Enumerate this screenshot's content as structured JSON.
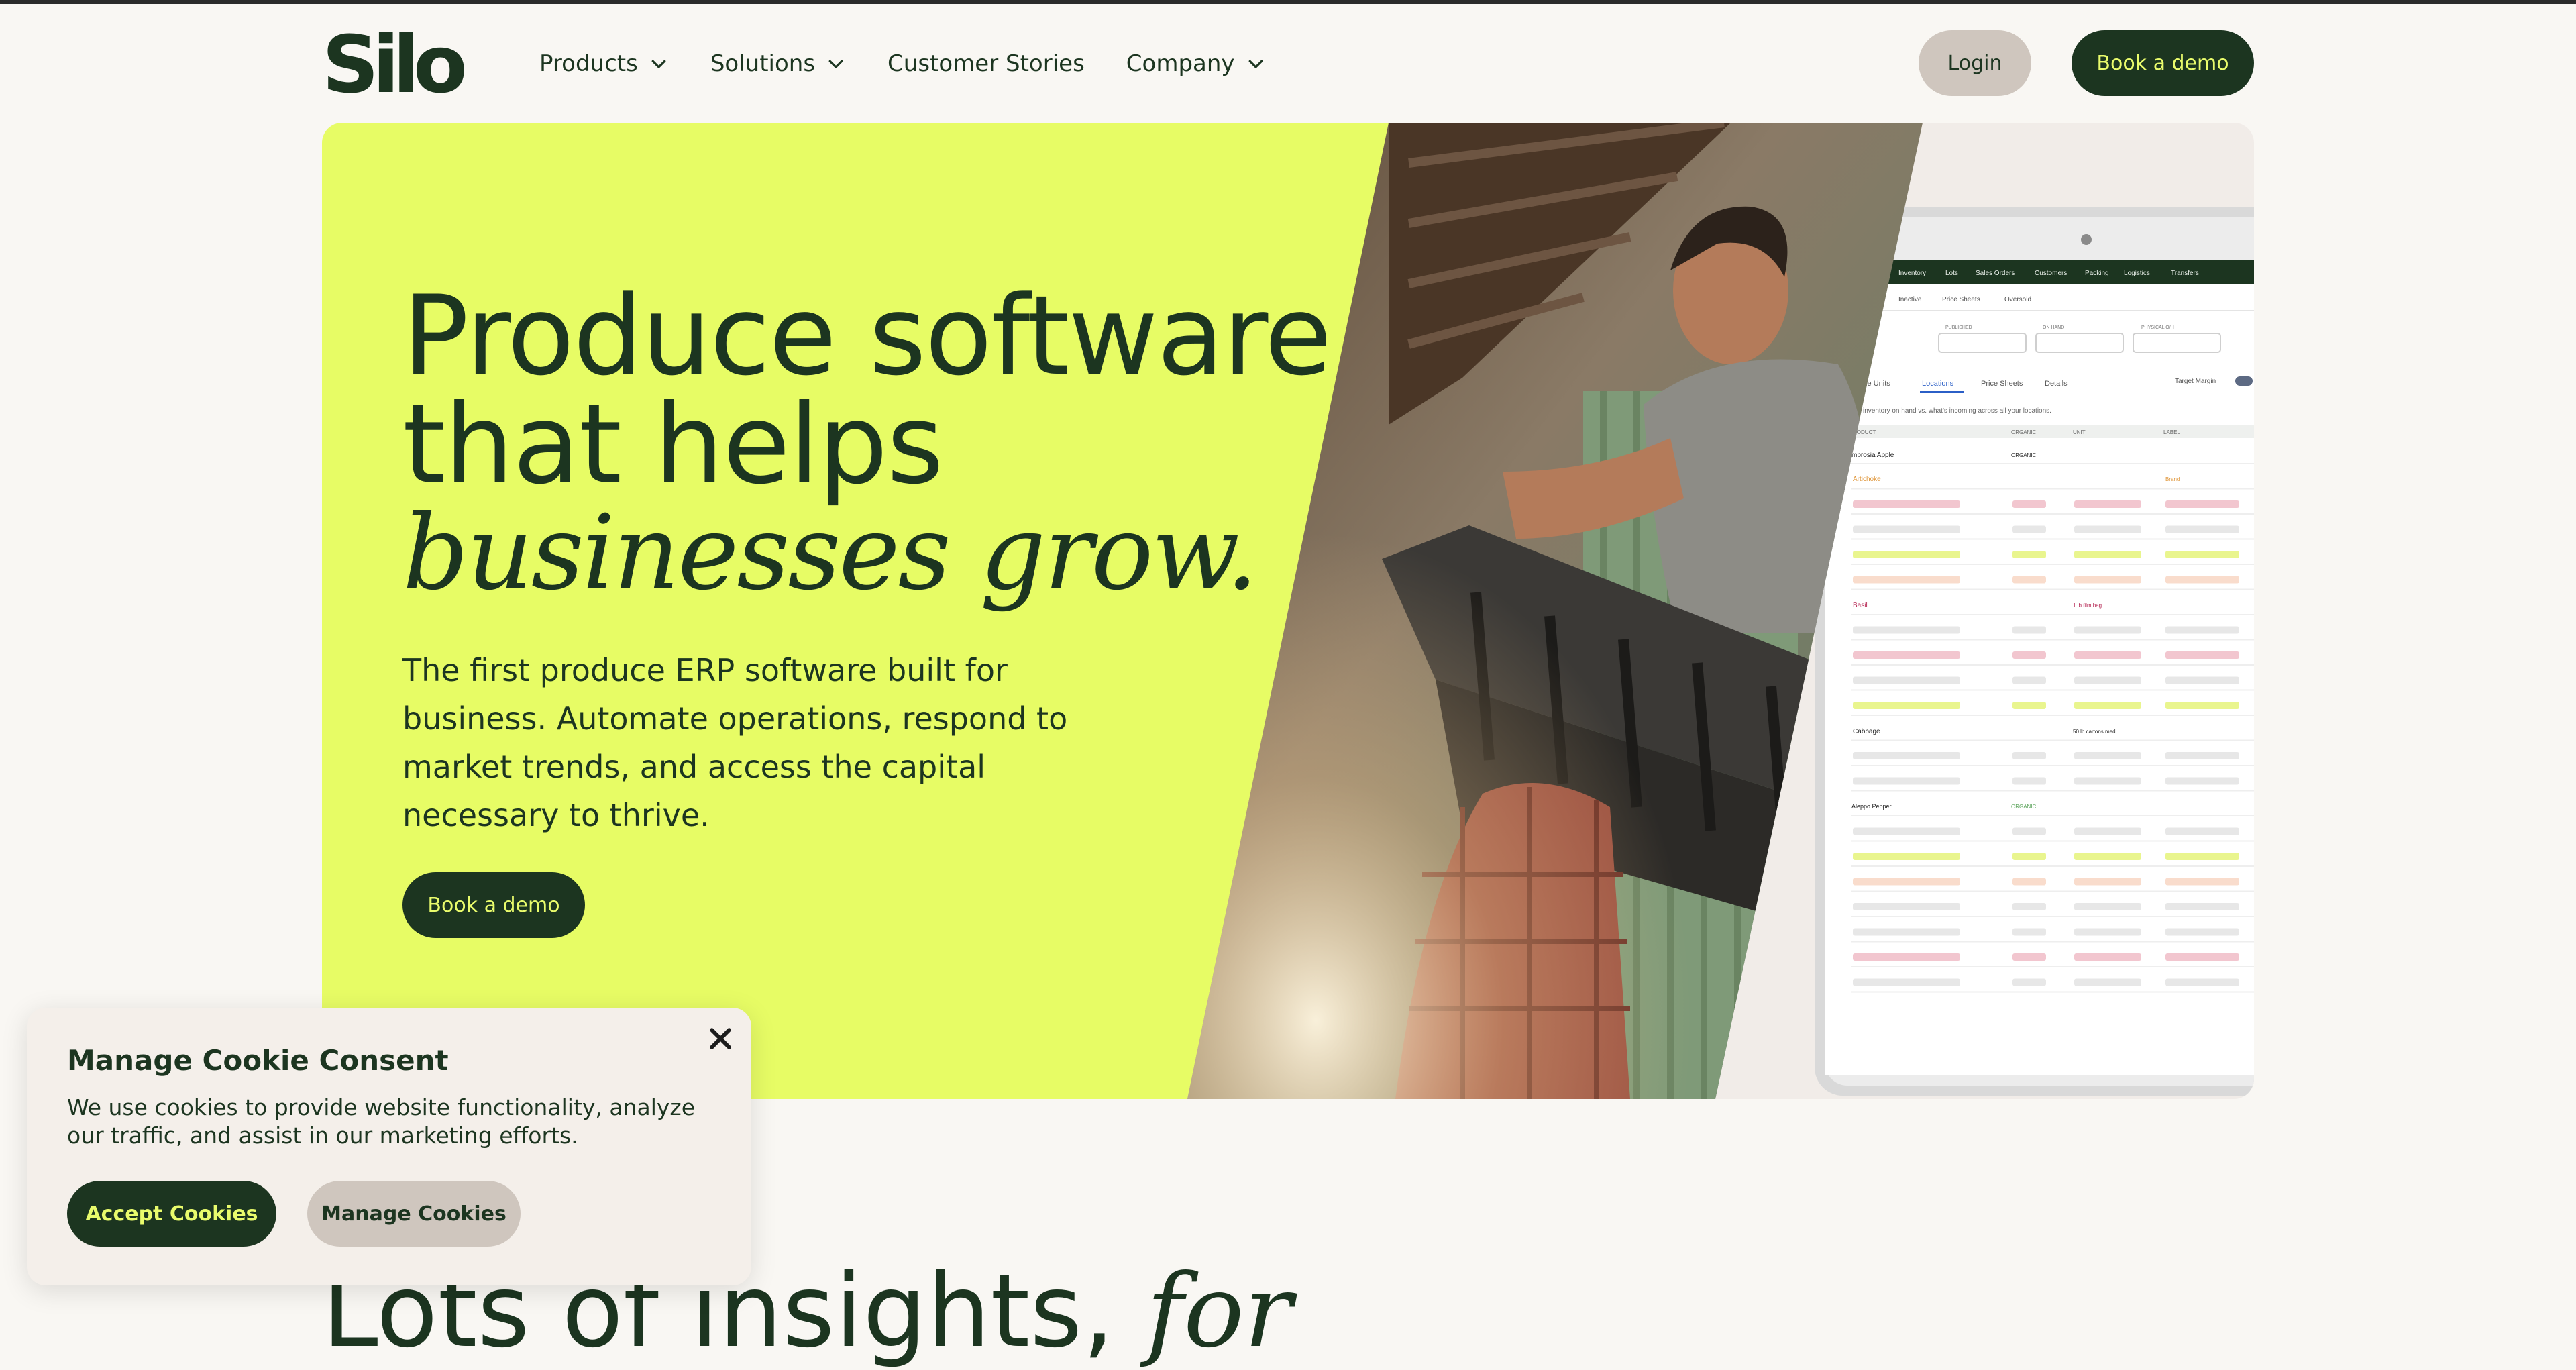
{
  "brand": {
    "logo": "Silo",
    "accent": "#e9fb6c",
    "dark": "#1c3520"
  },
  "nav": {
    "items": [
      {
        "label": "Products",
        "dropdown": true
      },
      {
        "label": "Solutions",
        "dropdown": true
      },
      {
        "label": "Customer Stories",
        "dropdown": false
      },
      {
        "label": "Company",
        "dropdown": true
      }
    ],
    "login": "Login",
    "demo": "Book a demo"
  },
  "hero": {
    "title_line1": "Produce software",
    "title_line2": "that helps",
    "title_italic": "businesses grow.",
    "description": "The first produce ERP software built for business. Automate operations, respond to market trends, and access the capital necessary to thrive.",
    "cta": "Book a demo",
    "image": "worker-lifting-crate-photo",
    "screenshot": {
      "tabs_top": [
        "Inventory",
        "Lots",
        "Sales Orders",
        "Customers",
        "Packing",
        "Logistics",
        "Transfers"
      ],
      "subtabs": [
        "Inactive",
        "Price Sheets",
        "Oversold"
      ],
      "filters": [
        "PUBLISHED",
        "ON HAND",
        "PHYSICAL O/H"
      ],
      "view_tabs": [
        "ble Units",
        "Locations",
        "Price Sheets",
        "Details"
      ],
      "toggle_label": "Target Margin",
      "caption": "inventory on hand vs. what's incoming across all your locations.",
      "columns": [
        "RODUCT",
        "ORGANIC",
        "UNIT",
        "LABEL"
      ],
      "rows": [
        {
          "product": "mbrosia Apple",
          "organic": "ORGANIC",
          "unit": "",
          "label": ""
        },
        {
          "product": "Artichoke",
          "organic": "",
          "unit": "",
          "label": "Brand"
        },
        {
          "product": "Basil",
          "organic": "",
          "unit": "1 lb film bag",
          "label": ""
        },
        {
          "product": "Cabbage",
          "organic": "",
          "unit": "50 lb cartons med",
          "label": ""
        },
        {
          "product": "Aleppo Pepper",
          "organic": "ORGANIC",
          "unit": "",
          "label": ""
        }
      ]
    }
  },
  "section": {
    "heading": "Lots of insights,",
    "heading_italic": "for"
  },
  "cookie": {
    "title": "Manage Cookie Consent",
    "text": "We use cookies to provide website functionality, analyze our traffic, and assist in our marketing efforts.",
    "accept": "Accept Cookies",
    "manage": "Manage Cookies"
  }
}
